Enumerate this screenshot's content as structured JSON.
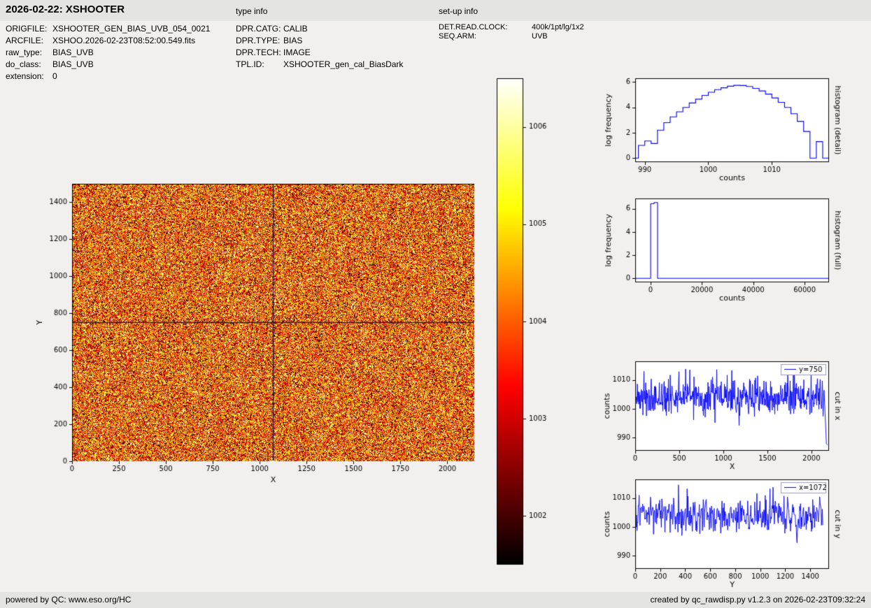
{
  "header": {
    "title": "2026-02-22: XSHOOTER",
    "type_info_label": "type info",
    "setup_info_label": "set-up info"
  },
  "metadata": {
    "file": [
      {
        "label": "ORIGFILE:",
        "value": "XSHOOTER_GEN_BIAS_UVB_054_0021"
      },
      {
        "label": "ARCFILE:",
        "value": "XSHOO.2026-02-23T08:52:00.549.fits"
      },
      {
        "label": "raw_type:",
        "value": "BIAS_UVB"
      },
      {
        "label": "do_class:",
        "value": "BIAS_UVB"
      },
      {
        "label": "extension:",
        "value": "0"
      }
    ],
    "type": [
      {
        "label": "DPR.CATG:",
        "value": "CALIB"
      },
      {
        "label": "DPR.TYPE:",
        "value": "BIAS"
      },
      {
        "label": "DPR.TECH:",
        "value": "IMAGE"
      },
      {
        "label": "TPL.ID:",
        "value": "XSHOOTER_gen_cal_BiasDark"
      }
    ],
    "setup": [
      {
        "label": "DET.READ.CLOCK:",
        "value": "400k/1pt/lg/1x2"
      },
      {
        "label": "SEQ.ARM:",
        "value": "UVB"
      }
    ]
  },
  "footer": {
    "left": "powered by QC: www.eso.org/HC",
    "right": "created by qc_rawdisp.py v1.2.3 on 2026-02-23T09:32:24"
  },
  "colors": {
    "line": "#0000ff",
    "crosshair": "#0a0a50",
    "page_bg": "#f1f0ee",
    "bar_bg": "#e4e4e2"
  },
  "chart_data": [
    {
      "id": "raw_image",
      "type": "heatmap",
      "xlabel": "X",
      "ylabel": "Y",
      "xlim": [
        0,
        2144
      ],
      "ylim": [
        0,
        1500
      ],
      "xticks": [
        0,
        250,
        500,
        750,
        1000,
        1250,
        1500,
        1750,
        2000
      ],
      "yticks": [
        0,
        200,
        400,
        600,
        800,
        1000,
        1200,
        1400
      ],
      "value_mean": 1004,
      "value_sigma": 1.45,
      "vmin": 1001.5,
      "vmax": 1006.5,
      "colormap": "hot",
      "crosshair": {
        "x": 1072,
        "y": 750
      },
      "seed": 42
    },
    {
      "id": "colorbar",
      "type": "colorbar",
      "colormap": "hot",
      "vmin": 1001.5,
      "vmax": 1006.5,
      "ticks": [
        1002,
        1003,
        1004,
        1005,
        1006
      ]
    },
    {
      "id": "hist_detail",
      "type": "histogram",
      "xlabel": "counts",
      "ylabel": "log frequency",
      "right_label": "histogram (detail)",
      "xlim": [
        988.5,
        1019
      ],
      "ylim": [
        -0.32,
        6.3
      ],
      "xticks": [
        990,
        1000,
        1010
      ],
      "yticks": [
        0,
        2,
        4,
        6
      ],
      "bin_start": 989,
      "bin_width": 1,
      "log_frequency": [
        1.0,
        1.35,
        1.15,
        2.2,
        2.8,
        3.25,
        3.65,
        4.0,
        4.35,
        4.65,
        4.95,
        5.2,
        5.4,
        5.55,
        5.67,
        5.74,
        5.73,
        5.65,
        5.5,
        5.3,
        5.05,
        4.75,
        4.4,
        4.0,
        3.5,
        2.9,
        2.1,
        0.0,
        1.3,
        0.0
      ]
    },
    {
      "id": "hist_full",
      "type": "histogram",
      "xlabel": "counts",
      "ylabel": "log frequency",
      "right_label": "histogram (full)",
      "xlim": [
        -6000,
        69500
      ],
      "ylim": [
        -0.35,
        6.9
      ],
      "xticks": [
        0,
        20000,
        40000,
        60000
      ],
      "yticks": [
        0,
        2,
        4,
        6
      ],
      "bin_start": 0,
      "bin_width": 1350,
      "log_frequency": [
        6.45,
        6.55
      ]
    },
    {
      "id": "cut_x",
      "type": "line",
      "legend": "y=750",
      "xlabel": "X",
      "ylabel": "counts",
      "right_label": "cut in x",
      "xlim": [
        0,
        2200
      ],
      "ylim": [
        985.5,
        1016.5
      ],
      "xticks": [
        0,
        500,
        1000,
        1500,
        2000
      ],
      "yticks": [
        990,
        1000,
        1010
      ],
      "data_max": 2144,
      "n_points": 540,
      "mean": 1004,
      "sigma": 3.0,
      "seed": 7,
      "tail": {
        "x": 2170,
        "y": 988
      }
    },
    {
      "id": "cut_y",
      "type": "line",
      "legend": "x=1072",
      "xlabel": "Y",
      "ylabel": "counts",
      "right_label": "cut in y",
      "xlim": [
        0,
        1550
      ],
      "ylim": [
        985.5,
        1016.5
      ],
      "xticks": [
        0,
        200,
        400,
        600,
        800,
        1000,
        1200,
        1400
      ],
      "yticks": [
        990,
        1000,
        1010
      ],
      "data_max": 1500,
      "n_points": 430,
      "mean": 1004,
      "sigma": 3.0,
      "seed": 13
    }
  ]
}
